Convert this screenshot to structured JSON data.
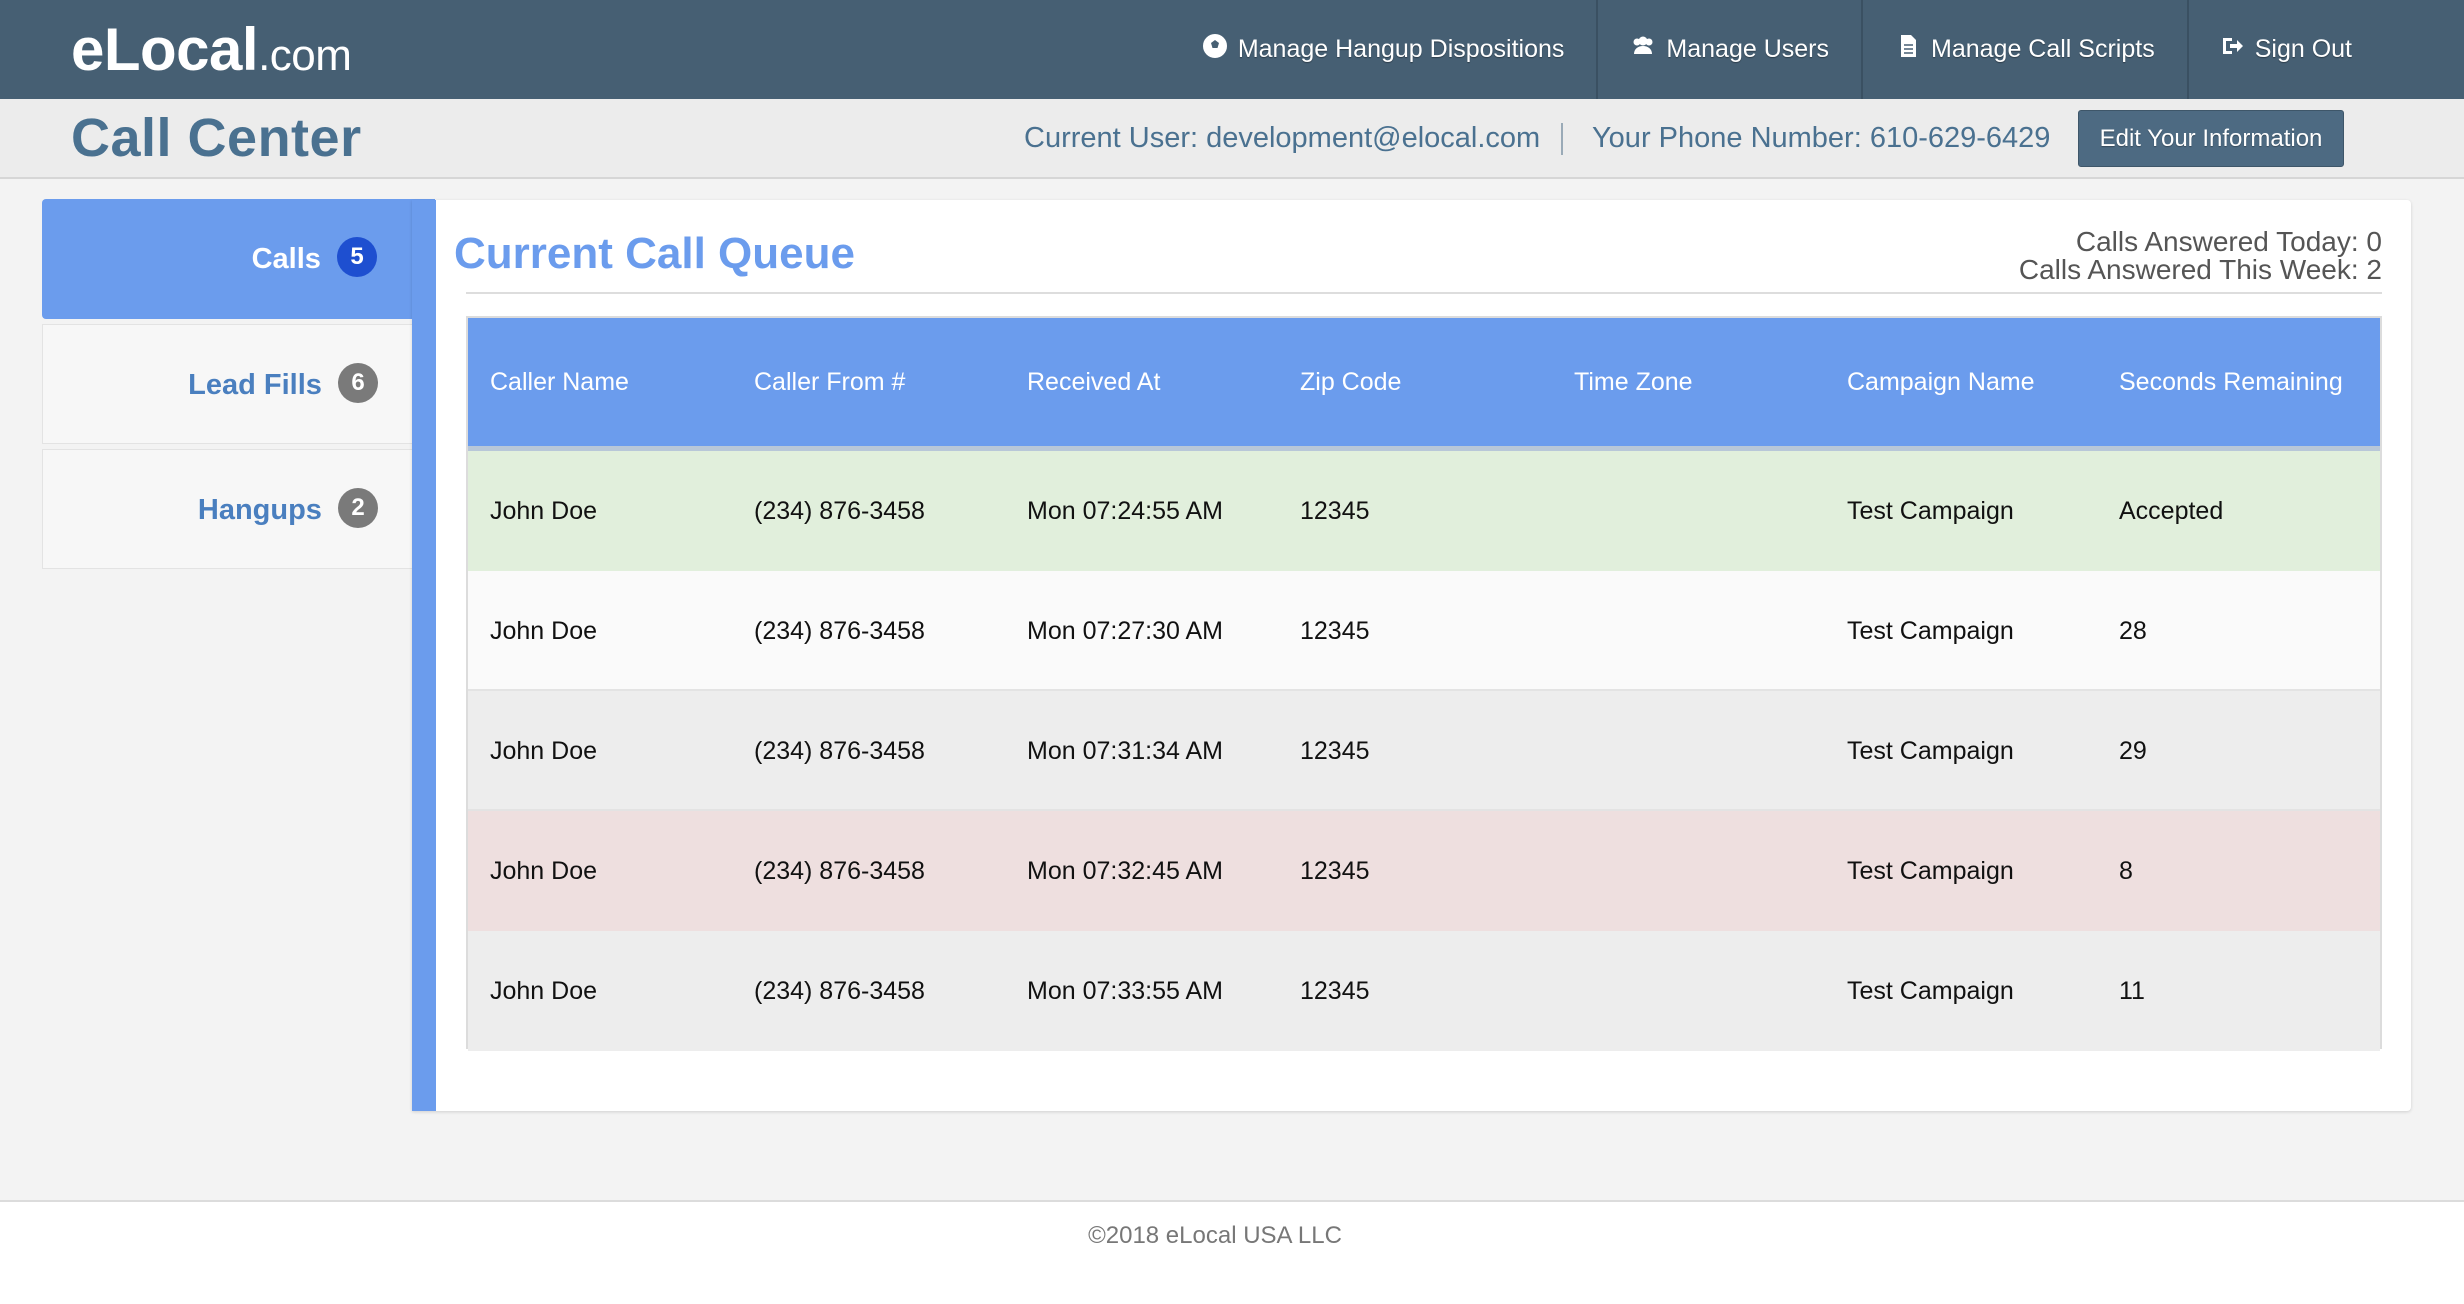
{
  "header": {
    "logo_main": "eLocal",
    "logo_suffix": ".com",
    "nav": [
      {
        "label": "Manage Hangup Dispositions",
        "icon": "soccer-ball-icon"
      },
      {
        "label": "Manage Users",
        "icon": "users-icon"
      },
      {
        "label": "Manage Call Scripts",
        "icon": "document-icon"
      },
      {
        "label": "Sign Out",
        "icon": "sign-out-icon"
      }
    ]
  },
  "subheader": {
    "title": "Call Center",
    "current_user": "Current User: development@elocal.com",
    "phone": "Your Phone Number: 610-629-6429",
    "edit_button": "Edit Your Information"
  },
  "tabs": [
    {
      "label": "Calls",
      "count": "5",
      "active": true
    },
    {
      "label": "Lead Fills",
      "count": "6",
      "active": false
    },
    {
      "label": "Hangups",
      "count": "2",
      "active": false
    }
  ],
  "queue": {
    "title": "Current Call Queue",
    "answered_today": "Calls Answered Today: 0",
    "answered_week": "Calls Answered This Week: 2",
    "columns": [
      "Caller Name",
      "Caller From #",
      "Received At",
      "Zip Code",
      "Time Zone",
      "Campaign Name",
      "Seconds Remaining"
    ],
    "rows": [
      [
        "John Doe",
        "(234) 876-3458",
        "Mon 07:24:55 AM",
        "12345",
        "",
        "Test Campaign",
        "Accepted"
      ],
      [
        "John Doe",
        "(234) 876-3458",
        "Mon 07:27:30 AM",
        "12345",
        "",
        "Test Campaign",
        "28"
      ],
      [
        "John Doe",
        "(234) 876-3458",
        "Mon 07:31:34 AM",
        "12345",
        "",
        "Test Campaign",
        "29"
      ],
      [
        "John Doe",
        "(234) 876-3458",
        "Mon 07:32:45 AM",
        "12345",
        "",
        "Test Campaign",
        "8"
      ],
      [
        "John Doe",
        "(234) 876-3458",
        "Mon 07:33:55 AM",
        "12345",
        "",
        "Test Campaign",
        "11"
      ]
    ]
  },
  "footer": {
    "text": "©2018 eLocal USA LLC"
  },
  "colors": {
    "nav_bg": "#465f73",
    "accent_blue": "#6b9ced",
    "accepted_row": "#e1efdc",
    "urgent_row": "#eedfdf"
  }
}
